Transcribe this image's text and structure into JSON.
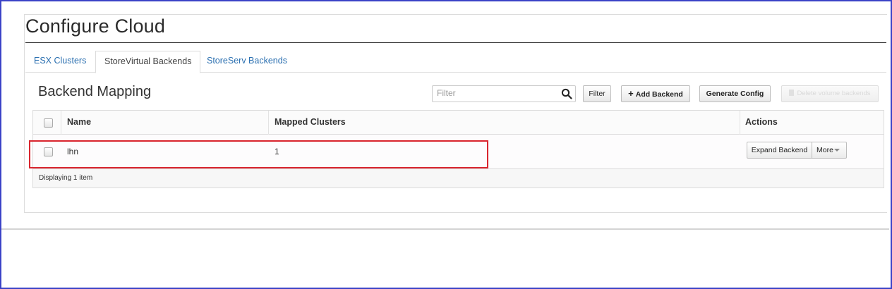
{
  "page": {
    "title": "Configure Cloud"
  },
  "tabs": [
    {
      "label": "ESX Clusters",
      "active": false
    },
    {
      "label": "StoreVirtual Backends",
      "active": true
    },
    {
      "label": "StoreServ Backends",
      "active": false
    }
  ],
  "section": {
    "title": "Backend Mapping"
  },
  "filter": {
    "placeholder": "Filter",
    "value": ""
  },
  "toolbar": {
    "filter_label": "Filter",
    "add_label": "Add Backend",
    "generate_label": "Generate Config",
    "delete_label": "Delete volume backends"
  },
  "table": {
    "columns": [
      "Name",
      "Mapped Clusters",
      "Actions"
    ],
    "rows": [
      {
        "name": "lhn",
        "mapped_clusters": "1",
        "action_primary": "Expand Backend",
        "action_more": "More"
      }
    ],
    "footer": "Displaying 1 item"
  },
  "colors": {
    "link": "#2a6fb0",
    "highlight": "#d9252e",
    "frame": "#3b43c7"
  },
  "icons": {
    "search": "search-icon",
    "plus": "plus-icon",
    "trash": "trash-icon",
    "caret": "caret-down-icon"
  }
}
